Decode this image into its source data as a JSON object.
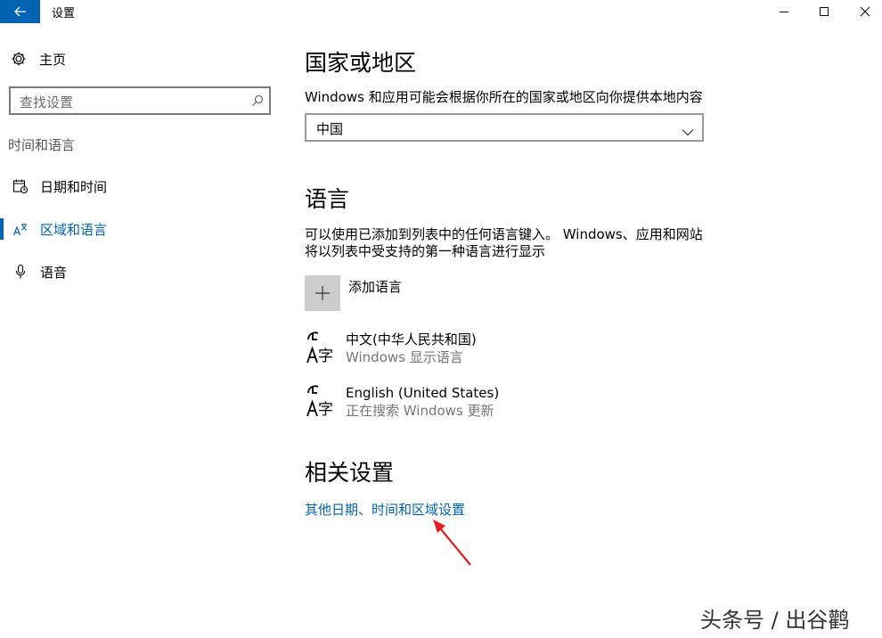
{
  "window": {
    "title": "设置"
  },
  "sidebar": {
    "home_label": "主页",
    "search_placeholder": "查找设置",
    "section_label": "时间和语言",
    "items": [
      {
        "label": "日期和时间",
        "icon": "calendar-clock-icon",
        "active": false
      },
      {
        "label": "区域和语言",
        "icon": "region-language-icon",
        "active": true
      },
      {
        "label": "语音",
        "icon": "microphone-icon",
        "active": false
      }
    ]
  },
  "region": {
    "heading": "国家或地区",
    "description": "Windows 和应用可能会根据你所在的国家或地区向你提供本地内容",
    "selected_country": "中国"
  },
  "language": {
    "heading": "语言",
    "description_line1": "可以使用已添加到列表中的任何语言键入。 Windows、应用和网站",
    "description_line2": "将以列表中受支持的第一种语言进行显示",
    "add_label": "添加语言",
    "items": [
      {
        "name": "中文(中华人民共和国)",
        "status": "Windows 显示语言"
      },
      {
        "name": "English (United States)",
        "status": "正在搜索 Windows 更新"
      }
    ]
  },
  "related": {
    "heading": "相关设置",
    "link": "其他日期、时间和区域设置"
  },
  "watermark": "头条号 / 出谷鹳",
  "colors": {
    "accent": "#0063b1",
    "annotation_arrow": "#e02020"
  }
}
